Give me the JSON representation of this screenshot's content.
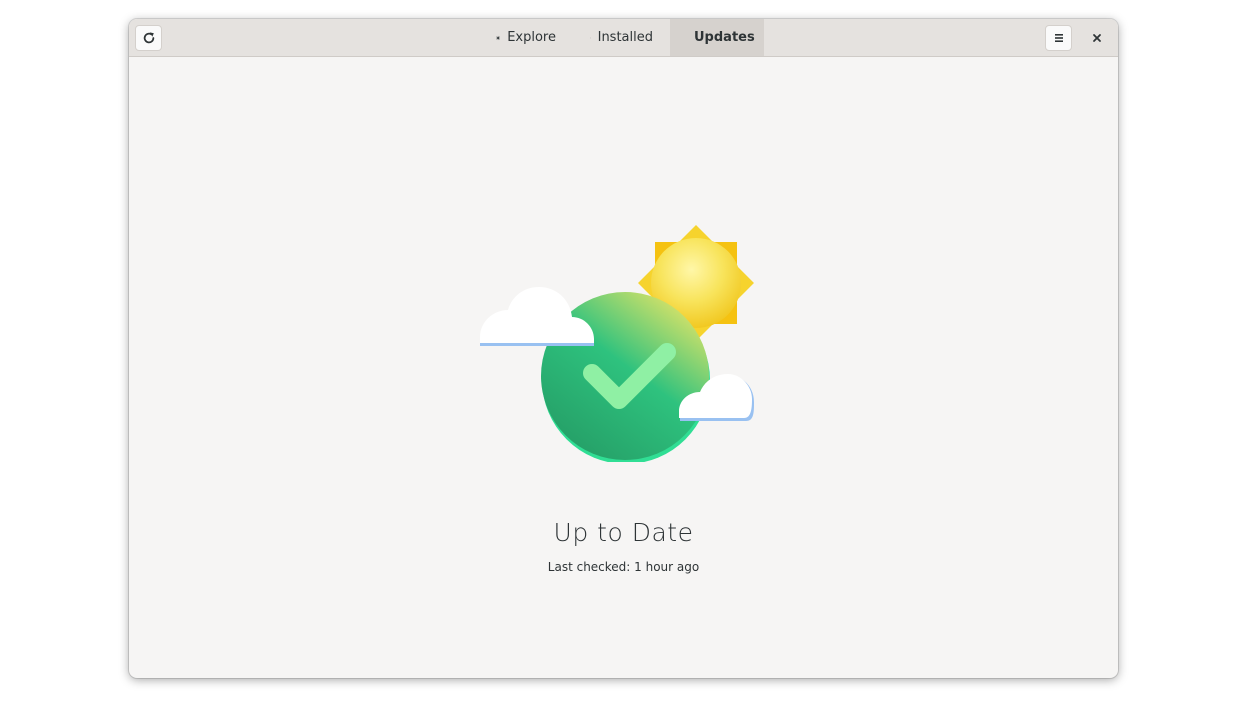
{
  "headerbar": {
    "refresh_icon": "refresh-icon",
    "menu_icon": "hamburger-menu-icon",
    "close_icon": "close-icon",
    "tabs": [
      {
        "label": "Explore",
        "icon": "explore-icon",
        "active": false
      },
      {
        "label": "Installed",
        "icon": "installed-check-icon",
        "active": false
      },
      {
        "label": "Updates",
        "icon": "updates-sync-icon",
        "active": true
      }
    ]
  },
  "main": {
    "illustration": "up-to-date-illustration",
    "title": "Up to Date",
    "subtitle": "Last checked: 1 hour ago"
  },
  "colors": {
    "window_bg": "#f6f5f4",
    "headerbar_bg": "#e5e2df",
    "active_tab_bg": "#d6d2ce",
    "text": "#2e3436",
    "accent_green": "#26a269",
    "sun_yellow": "#f6d32d"
  }
}
